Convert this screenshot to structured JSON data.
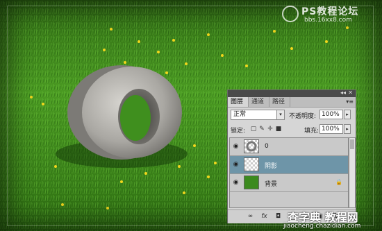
{
  "watermark": {
    "top_title": "PS教程论坛",
    "top_url": "bbs.16xx8.com",
    "bottom_title": "查字典 教程网",
    "bottom_url": "jiaocheng.chazidian.com"
  },
  "panel": {
    "tabs": [
      {
        "label": "图层",
        "active": true
      },
      {
        "label": "通道",
        "active": false
      },
      {
        "label": "路径",
        "active": false
      }
    ],
    "blend_mode": "正常",
    "opacity_label": "不透明度:",
    "opacity_value": "100%",
    "lock_label": "锁定:",
    "fill_label": "填充:",
    "fill_value": "100%",
    "layers": [
      {
        "name": "0",
        "selected": false,
        "thumb": "transparent"
      },
      {
        "name": "阴影",
        "selected": true,
        "thumb": "transparent"
      },
      {
        "name": "背景",
        "selected": false,
        "thumb": "grass",
        "locked": true
      }
    ],
    "bottom_icons": [
      "link-icon",
      "fx-icon",
      "mask-icon",
      "adjustment-icon",
      "folder-icon",
      "new-layer-icon",
      "trash-icon"
    ]
  },
  "colors": {
    "grass": "#3d7a1f",
    "selected_layer": "#6e95a8",
    "panel_bg": "#d6d6d6"
  }
}
